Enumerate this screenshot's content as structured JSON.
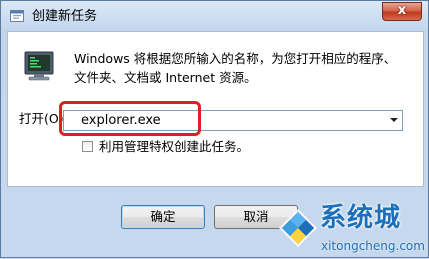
{
  "window": {
    "title": "创建新任务",
    "close_glyph": "x"
  },
  "dialog": {
    "description_line1": "Windows 将根据您所输入的名称，为您打开相应的程序、",
    "description_line2": "文件夹、文档或 Internet 资源。",
    "open_label": "打开(O):",
    "open_value": "explorer.exe",
    "checkbox_label": "利用管理特权创建此任务。",
    "checkbox_checked": false
  },
  "buttons": {
    "ok_label": "确定",
    "cancel_label": "取消"
  },
  "watermark": {
    "brand": "系统城",
    "url": "xitongcheng.com"
  },
  "icons": {
    "title": "run-dialog-icon",
    "run": "computer-run-icon",
    "watermark_logo": "windows-logo-icon"
  },
  "colors": {
    "highlight": "#e0201e",
    "close_button": "#c1391d",
    "watermark": "#1c6fb8"
  }
}
